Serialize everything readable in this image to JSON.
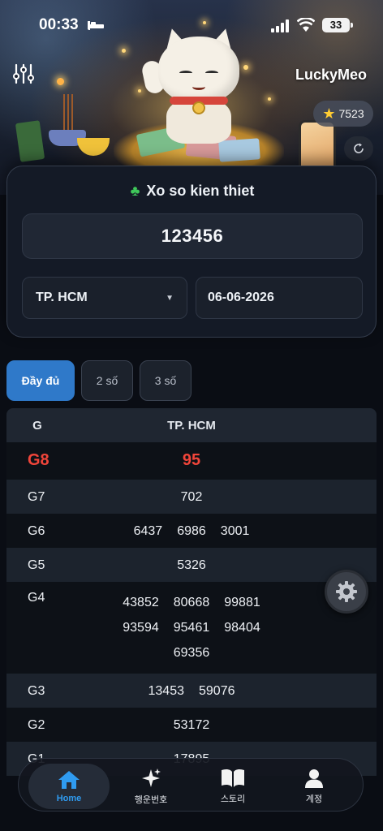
{
  "status_bar": {
    "time": "00:33",
    "battery": "33"
  },
  "header": {
    "app_name": "LuckyMeo",
    "points": "7523"
  },
  "card": {
    "title": "Xo so kien thiet",
    "ticket_number": "123456",
    "province": "TP. HCM",
    "date": "06-06-2026"
  },
  "tabs": [
    {
      "label": "Đầy đủ",
      "active": true
    },
    {
      "label": "2 số",
      "active": false
    },
    {
      "label": "3 số",
      "active": false
    }
  ],
  "table": {
    "headers": {
      "prize": "G",
      "province": "TP. HCM"
    },
    "rows": [
      {
        "prize": "G8",
        "numbers": [
          "95"
        ],
        "highlight": true
      },
      {
        "prize": "G7",
        "numbers": [
          "702"
        ]
      },
      {
        "prize": "G6",
        "numbers": [
          "6437",
          "6986",
          "3001"
        ]
      },
      {
        "prize": "G5",
        "numbers": [
          "5326"
        ]
      },
      {
        "prize": "G4",
        "numbers": [
          "43852",
          "80668",
          "99881",
          "93594",
          "95461",
          "98404",
          "69356"
        ]
      },
      {
        "prize": "G3",
        "numbers": [
          "13453",
          "59076"
        ]
      },
      {
        "prize": "G2",
        "numbers": [
          "53172"
        ]
      },
      {
        "prize": "G1",
        "numbers": [
          "17895"
        ]
      }
    ]
  },
  "nav": {
    "items": [
      {
        "label": "Home",
        "icon": "home-icon",
        "active": true
      },
      {
        "label": "행운번호",
        "icon": "sparkle-icon"
      },
      {
        "label": "스토리",
        "icon": "book-icon"
      },
      {
        "label": "계정",
        "icon": "user-icon"
      }
    ]
  },
  "colors": {
    "accent": "#2f79c9",
    "highlight": "#f0453a",
    "nav_active": "#2f9bf0"
  }
}
